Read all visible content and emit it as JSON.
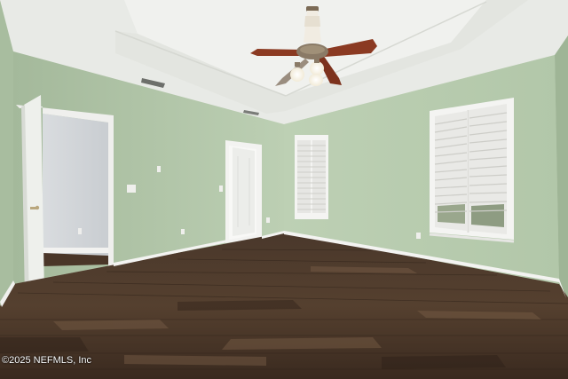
{
  "photo": {
    "watermark": "©2025 NEFMLS, Inc",
    "colors": {
      "wall": "#b9cdb0",
      "wall_shadow": "#a9bea0",
      "ceiling": "#ecedea",
      "tray": "#f1f2ef",
      "floor_dark": "#3b2b20",
      "floor_mid": "#56402f",
      "floor_light": "#6c5441",
      "trim": "#f3f3f1",
      "fan_blade": "#8a3a24",
      "fan_metal": "#8a7a66"
    }
  }
}
